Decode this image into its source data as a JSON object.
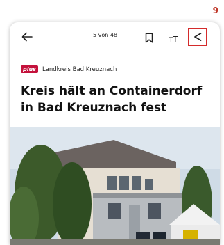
{
  "annotation": {
    "number": "9"
  },
  "toolbar": {
    "counter": "5 von 48",
    "text_size_small": "T",
    "text_size_big": "T"
  },
  "article": {
    "badge": "plus",
    "kicker": "Landkreis Bad Kreuznach",
    "headline": "Kreis hält an Containerdorf in Bad Kreuznach fest"
  },
  "colors": {
    "badge": "#c4123c",
    "highlight": "#d42b2b"
  },
  "icons": [
    "back-arrow-icon",
    "bookmark-icon",
    "text-size-icon",
    "share-icon"
  ]
}
